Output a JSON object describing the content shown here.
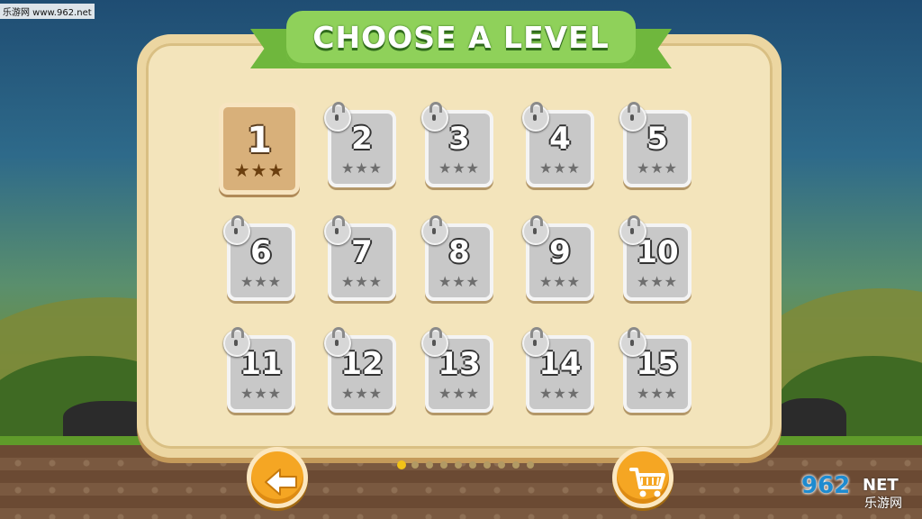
{
  "watermark_top": "乐游网 www.962.net",
  "title": "CHOOSE A LEVEL",
  "levels": [
    {
      "number": "1",
      "stars": "★★★",
      "locked": false
    },
    {
      "number": "2",
      "stars": "★★★",
      "locked": true
    },
    {
      "number": "3",
      "stars": "★★★",
      "locked": true
    },
    {
      "number": "4",
      "stars": "★★★",
      "locked": true
    },
    {
      "number": "5",
      "stars": "★★★",
      "locked": true
    },
    {
      "number": "6",
      "stars": "★★★",
      "locked": true
    },
    {
      "number": "7",
      "stars": "★★★",
      "locked": true
    },
    {
      "number": "8",
      "stars": "★★★",
      "locked": true
    },
    {
      "number": "9",
      "stars": "★★★",
      "locked": true
    },
    {
      "number": "10",
      "stars": "★★★",
      "locked": true
    },
    {
      "number": "11",
      "stars": "★★★",
      "locked": true
    },
    {
      "number": "12",
      "stars": "★★★",
      "locked": true
    },
    {
      "number": "13",
      "stars": "★★★",
      "locked": true
    },
    {
      "number": "14",
      "stars": "★★★",
      "locked": true
    },
    {
      "number": "15",
      "stars": "★★★",
      "locked": true
    }
  ],
  "pagination": {
    "pages": 10,
    "current": 1
  },
  "buttons": {
    "back_icon": "arrow-left-icon",
    "shop_icon": "shopping-cart-icon"
  },
  "watermark_br": {
    "logo": "962",
    "net": "NET",
    "cn": "乐游网"
  },
  "colors": {
    "ribbon": "#8fd15a",
    "panel": "#f3e4bb",
    "button": "#f5a623",
    "locked_tile": "#c8c8c8",
    "unlocked_tile": "#d8b07a"
  }
}
